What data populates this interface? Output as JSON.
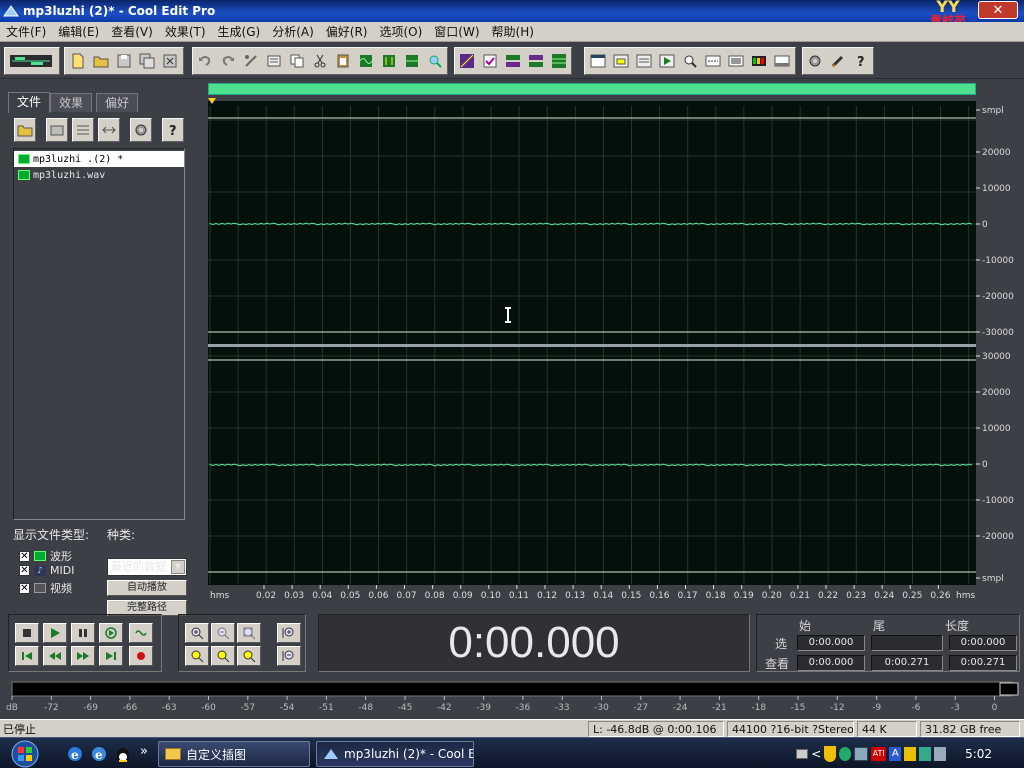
{
  "window": {
    "title": "mp3luzhi (2)* - Cool Edit Pro",
    "badge_top": "YY",
    "badge_bottom": "青蛙苑",
    "minimize": "_",
    "close": "✕"
  },
  "menu": [
    "文件(F)",
    "编辑(E)",
    "查看(V)",
    "效果(T)",
    "生成(G)",
    "分析(A)",
    "偏好(R)",
    "选项(O)",
    "窗口(W)",
    "帮助(H)"
  ],
  "panel": {
    "tabs": [
      "文件",
      "效果",
      "偏好"
    ],
    "files": [
      "mp3luzhi .(2) *",
      "mp3luzhi.wav"
    ],
    "show_types_label": "显示文件类型:",
    "sort_label": "种类:",
    "types": [
      "波形",
      "MIDI",
      "视频"
    ],
    "sort_value": "最近的数据",
    "auto_play": "自动播放",
    "full_path": "完整路径"
  },
  "waveform": {
    "top_channel_labels": [
      "smpl",
      "20000",
      "10000",
      "0",
      "-10000",
      "-20000",
      "-30000"
    ],
    "bottom_channel_labels": [
      "30000",
      "20000",
      "10000",
      "0",
      "-10000",
      "-20000",
      "smpl"
    ],
    "time_unit_left": "hms",
    "time_unit_right": "hms",
    "time_ticks": [
      "0.02",
      "0.03",
      "0.04",
      "0.05",
      "0.06",
      "0.07",
      "0.08",
      "0.09",
      "0.10",
      "0.11",
      "0.12",
      "0.13",
      "0.14",
      "0.15",
      "0.16",
      "0.17",
      "0.18",
      "0.19",
      "0.20",
      "0.21",
      "0.22",
      "0.23",
      "0.24",
      "0.25",
      "0.26"
    ]
  },
  "transport": {
    "time": "0:00.000"
  },
  "selection": {
    "col_begin": "始",
    "col_end": "尾",
    "col_length": "长度",
    "row_sel": "选",
    "row_view": "查看",
    "sel_begin": "0:00.000",
    "sel_end": "",
    "sel_length": "0:00.000",
    "view_begin": "0:00.000",
    "view_end": "0:00.271",
    "view_length": "0:00.271"
  },
  "meter": {
    "labels": [
      "dB",
      "-72",
      "-69",
      "-66",
      "-63",
      "-60",
      "-57",
      "-54",
      "-51",
      "-48",
      "-45",
      "-42",
      "-39",
      "-36",
      "-33",
      "-30",
      "-27",
      "-24",
      "-21",
      "-18",
      "-15",
      "-12",
      "-9",
      "-6",
      "-3",
      "0"
    ]
  },
  "status": {
    "state": "已停止",
    "level": "L: -46.8dB @  0:00.106",
    "format": "44100 ?16-bit ?Stereo",
    "size": "44 K",
    "free": "31.82 GB free"
  },
  "taskbar": {
    "overflow": "»",
    "task1": "自定义插图",
    "task2": "mp3luzhi (2)* - Cool E...",
    "clock": "5:02"
  }
}
